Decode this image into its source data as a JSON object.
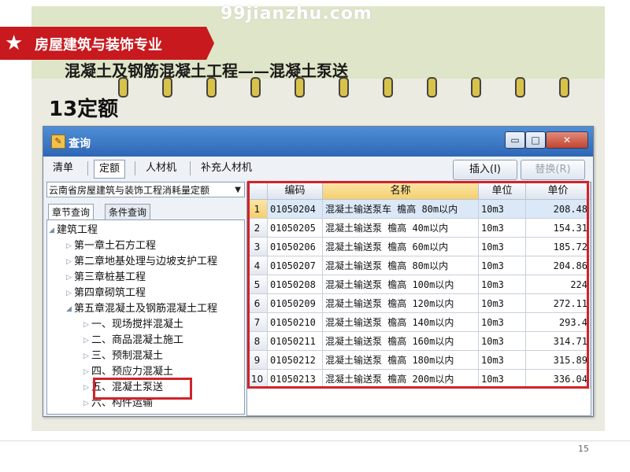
{
  "slide": {
    "watermark": "99jianzhu.com",
    "banner": "房屋建筑与装饰专业",
    "subtitle": "混凝土及钢筋混凝土工程——混凝土泵送",
    "heading": "13定额",
    "page_number": "15"
  },
  "window": {
    "title": "查询",
    "buttons": {
      "minimize": "▭",
      "maximize": "□",
      "close": "✕"
    }
  },
  "toolbar": {
    "tabs": [
      "清单",
      "定额",
      "人材机",
      "补充人材机"
    ],
    "active_tab": "定额",
    "insert_label": "插入(I)",
    "replace_label": "替换(R)"
  },
  "left_panel": {
    "combo_value": "云南省房屋建筑与装饰工程消耗量定额",
    "subtabs": [
      "章节查询",
      "条件查询"
    ],
    "tree": [
      {
        "label": "建筑工程",
        "level": 0,
        "expanded": true
      },
      {
        "label": "第一章土石方工程",
        "level": 1
      },
      {
        "label": "第二章地基处理与边坡支护工程",
        "level": 1
      },
      {
        "label": "第三章桩基工程",
        "level": 1
      },
      {
        "label": "第四章砌筑工程",
        "level": 1
      },
      {
        "label": "第五章混凝土及钢筋混凝土工程",
        "level": 1,
        "expanded": true
      },
      {
        "label": "一、现场搅拌混凝土",
        "level": 2
      },
      {
        "label": "二、商品混凝土施工",
        "level": 2
      },
      {
        "label": "三、预制混凝土",
        "level": 2
      },
      {
        "label": "四、预应力混凝土",
        "level": 2
      },
      {
        "label": "五、混凝土泵送",
        "level": 2,
        "selected": true
      },
      {
        "label": "六、构件运输",
        "level": 2
      }
    ]
  },
  "grid": {
    "columns": [
      "编码",
      "名称",
      "单位",
      "单价"
    ],
    "rows": [
      {
        "no": "1",
        "code": "01050204",
        "name": "混凝土输送泵车 檐高 80m以内",
        "unit": "10m3",
        "price": "208.48"
      },
      {
        "no": "2",
        "code": "01050205",
        "name": "混凝土输送泵 檐高 40m以内",
        "unit": "10m3",
        "price": "154.31"
      },
      {
        "no": "3",
        "code": "01050206",
        "name": "混凝土输送泵 檐高 60m以内",
        "unit": "10m3",
        "price": "185.72"
      },
      {
        "no": "4",
        "code": "01050207",
        "name": "混凝土输送泵 檐高 80m以内",
        "unit": "10m3",
        "price": "204.86"
      },
      {
        "no": "5",
        "code": "01050208",
        "name": "混凝土输送泵 檐高 100m以内",
        "unit": "10m3",
        "price": "224"
      },
      {
        "no": "6",
        "code": "01050209",
        "name": "混凝土输送泵 檐高 120m以内",
        "unit": "10m3",
        "price": "272.11"
      },
      {
        "no": "7",
        "code": "01050210",
        "name": "混凝土输送泵 檐高 140m以内",
        "unit": "10m3",
        "price": "293.4"
      },
      {
        "no": "8",
        "code": "01050211",
        "name": "混凝土输送泵 檐高 160m以内",
        "unit": "10m3",
        "price": "314.71"
      },
      {
        "no": "9",
        "code": "01050212",
        "name": "混凝土输送泵 檐高 180m以内",
        "unit": "10m3",
        "price": "315.89"
      },
      {
        "no": "10",
        "code": "01050213",
        "name": "混凝土输送泵 檐高 200m以内",
        "unit": "10m3",
        "price": "336.04"
      }
    ]
  },
  "colors": {
    "banner_red": "#c8191e",
    "highlight_red": "#d1232a",
    "title_blue": "#2e66b6"
  }
}
